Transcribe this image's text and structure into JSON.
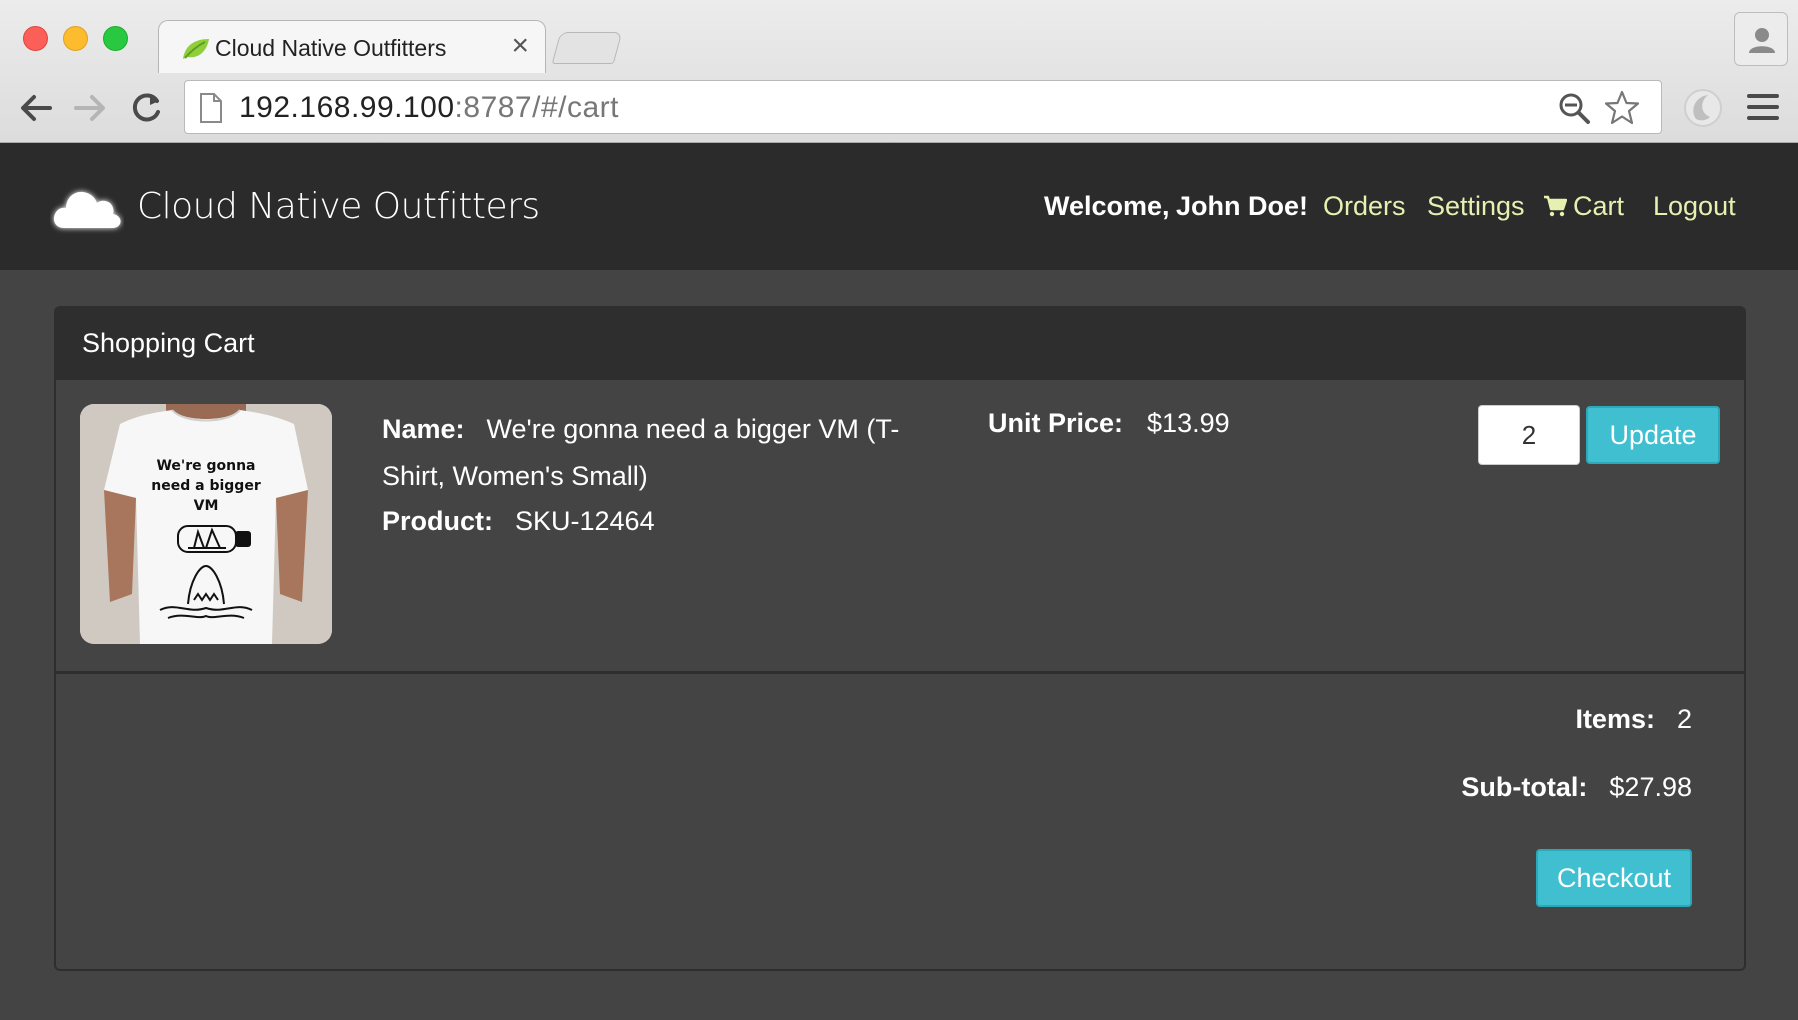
{
  "browser": {
    "tab_title": "Cloud Native Outfitters",
    "tab_close": "×",
    "url_host": "192.168.99.100",
    "url_rest": ":8787/#/cart"
  },
  "navbar": {
    "brand": "Cloud Native Outfitters",
    "welcome_label": "Welcome,",
    "user_name": "John Doe!",
    "links": {
      "orders": "Orders",
      "settings": "Settings",
      "cart": "Cart",
      "logout": "Logout"
    }
  },
  "cart": {
    "heading": "Shopping Cart",
    "item": {
      "image_text": [
        "We're gonna",
        "need a bigger",
        "VM"
      ],
      "name_label": "Name:",
      "name": "We're gonna need a bigger VM (T-Shirt, Women's Small)",
      "product_label": "Product:",
      "sku": "SKU-12464",
      "unit_price_label": "Unit Price:",
      "unit_price": "$13.99",
      "quantity": "2",
      "update_label": "Update"
    },
    "summary": {
      "items_label": "Items:",
      "items": "2",
      "subtotal_label": "Sub-total:",
      "subtotal": "$27.98",
      "checkout_label": "Checkout"
    }
  },
  "colors": {
    "navbar_bg": "#2b2b2b",
    "page_bg": "#444444",
    "link": "#e6f0b0",
    "button": "#3fbfd0"
  }
}
